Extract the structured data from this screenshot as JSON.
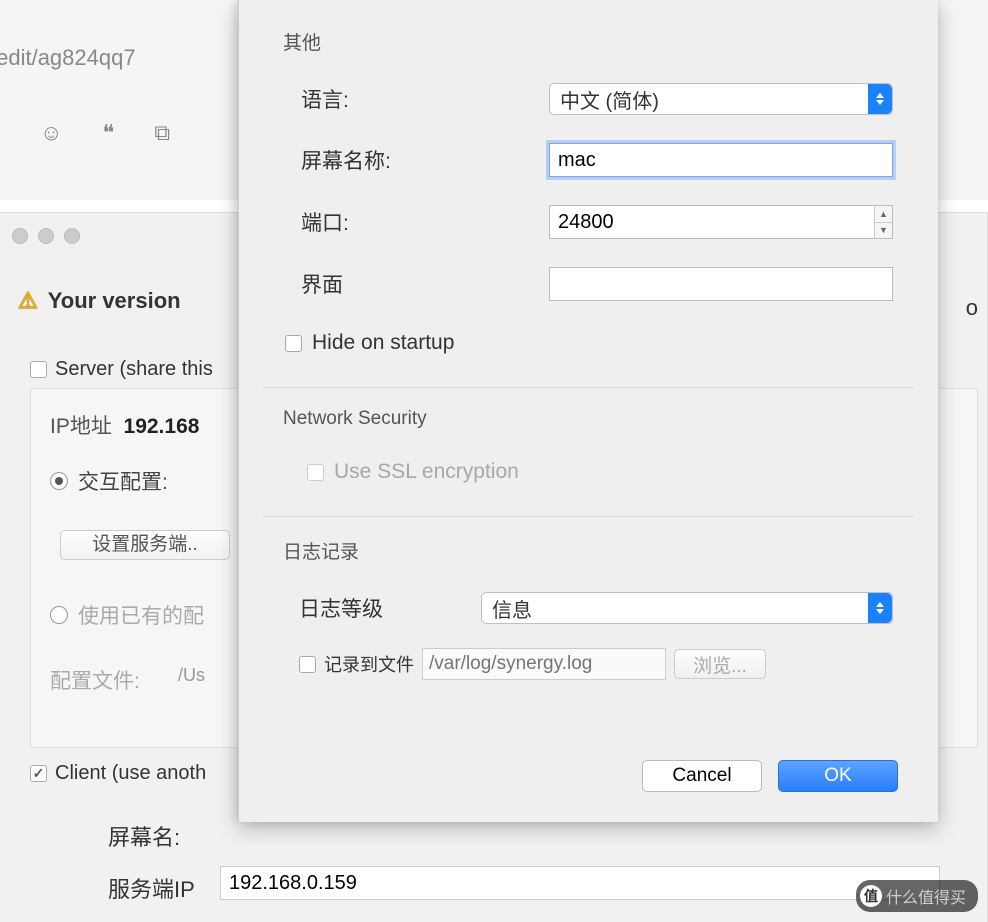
{
  "browser": {
    "url_fragment": "/edit/ag824qq7"
  },
  "main": {
    "warning_prefix": "Your version",
    "right_char": "o",
    "server_check_label": "Server (share this",
    "ip_label": "IP地址",
    "ip_value": "192.168",
    "radio1": "交互配置:",
    "config_btn": "设置服务端..",
    "radio2": "使用已有的配",
    "cfg_label": "配置文件:",
    "cfg_path": "/Us",
    "client_check_label": "Client (use anoth",
    "screen_name_label": "屏幕名:",
    "server_ip_label": "服务端IP",
    "server_ip_value": "192.168.0.159"
  },
  "dialog": {
    "section_other": "其他",
    "language_label": "语言:",
    "language_value": "中文 (简体)",
    "screen_label": "屏幕名称:",
    "screen_value": "mac",
    "port_label": "端口:",
    "port_value": "24800",
    "interface_label": "界面",
    "interface_value": "",
    "hide_label": "Hide on startup",
    "section_net": "Network Security",
    "ssl_label": "Use SSL encryption",
    "section_log": "日志记录",
    "log_level_label": "日志等级",
    "log_level_value": "信息",
    "log_file_label": "记录到文件",
    "log_file_placeholder": "/var/log/synergy.log",
    "browse_label": "浏览...",
    "cancel": "Cancel",
    "ok": "OK"
  },
  "watermark": {
    "icon": "值",
    "text": "什么值得买"
  }
}
